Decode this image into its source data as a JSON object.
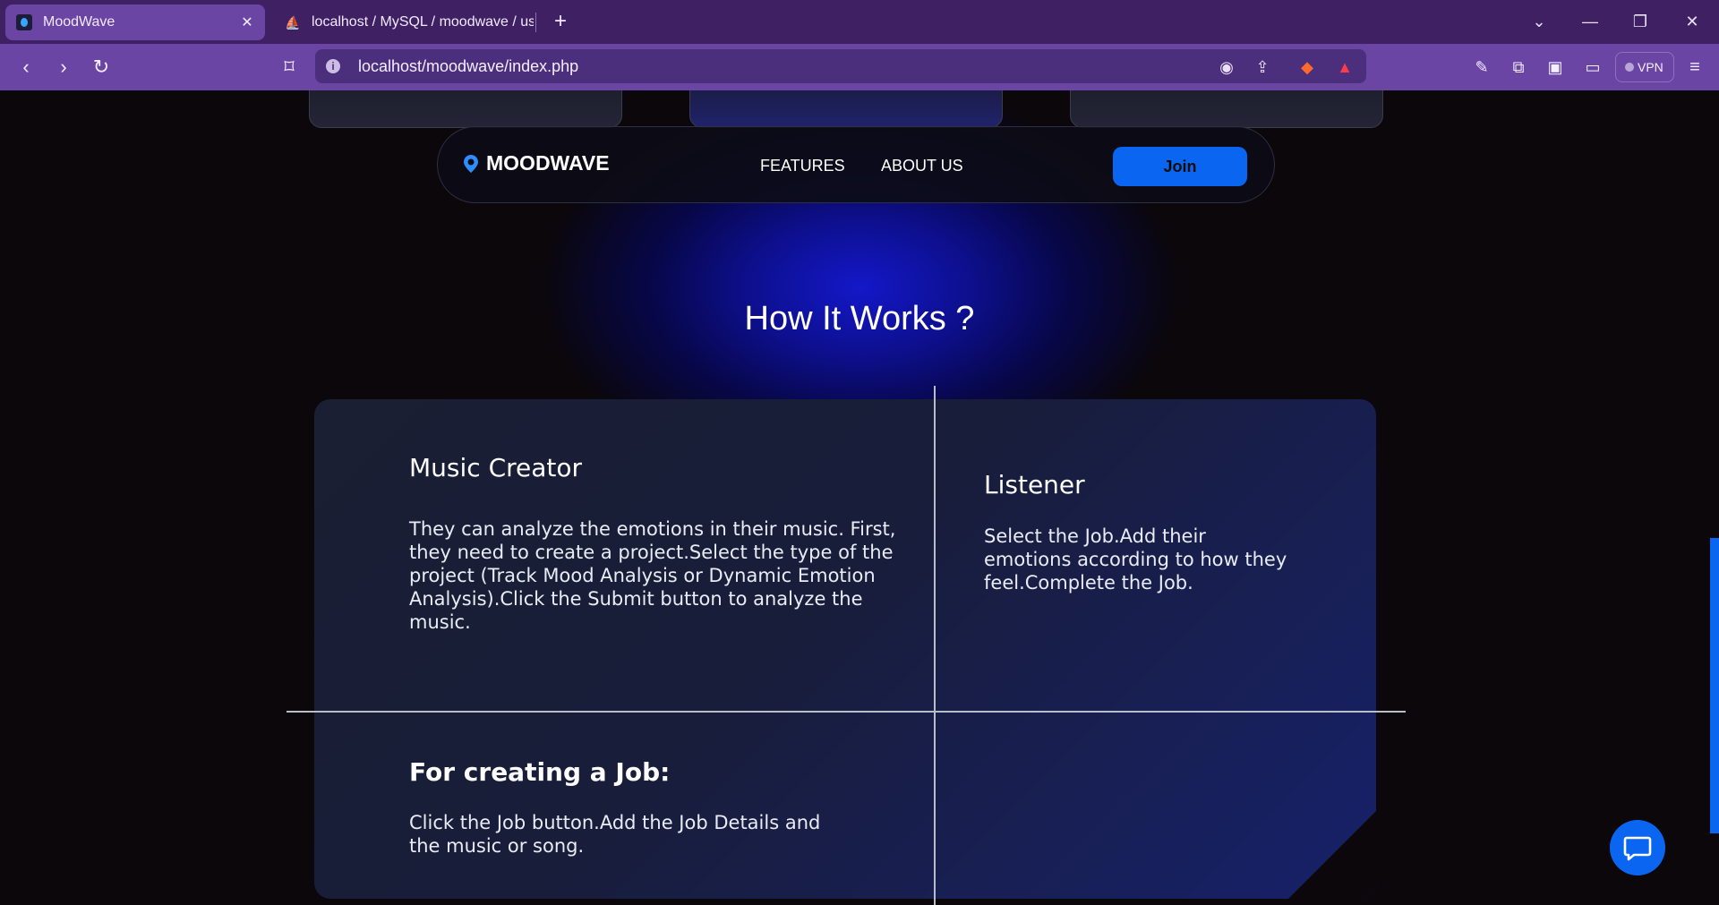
{
  "browser": {
    "tabs": [
      {
        "title": "MoodWave",
        "active": true
      },
      {
        "title": "localhost / MySQL / moodwave / use",
        "active": false
      }
    ],
    "address": "localhost/moodwave/index.php",
    "vpn_label": "VPN",
    "new_tab_symbol": "+",
    "colors": {
      "tabbar": "#3e2063",
      "toolbar": "#6a45a4"
    }
  },
  "navbar": {
    "logo": "MOODWAVE",
    "links": [
      "FEATURES",
      "ABOUT US"
    ],
    "join_label": "Join"
  },
  "section_title": "How It Works ?",
  "cards": {
    "creator": {
      "title": "Music Creator",
      "text_lines": [
        "They can analyze the emotions in their music. First,",
        "they need to create a project.Select the type of the",
        "project (Track Mood Analysis or Dynamic Emotion",
        "Analysis).Click the Submit button to analyze the",
        "music."
      ]
    },
    "listener": {
      "title": "Listener",
      "text_lines": [
        "Select the Job.Add their",
        "emotions according to how they",
        "feel.Complete the Job."
      ]
    },
    "job": {
      "title": "For creating a Job:",
      "text_lines": [
        "Click the Job button.Add the Job Details and",
        "the music or song."
      ]
    }
  },
  "colors": {
    "accent": "#0a66f0",
    "panel": "#1a1f33"
  }
}
